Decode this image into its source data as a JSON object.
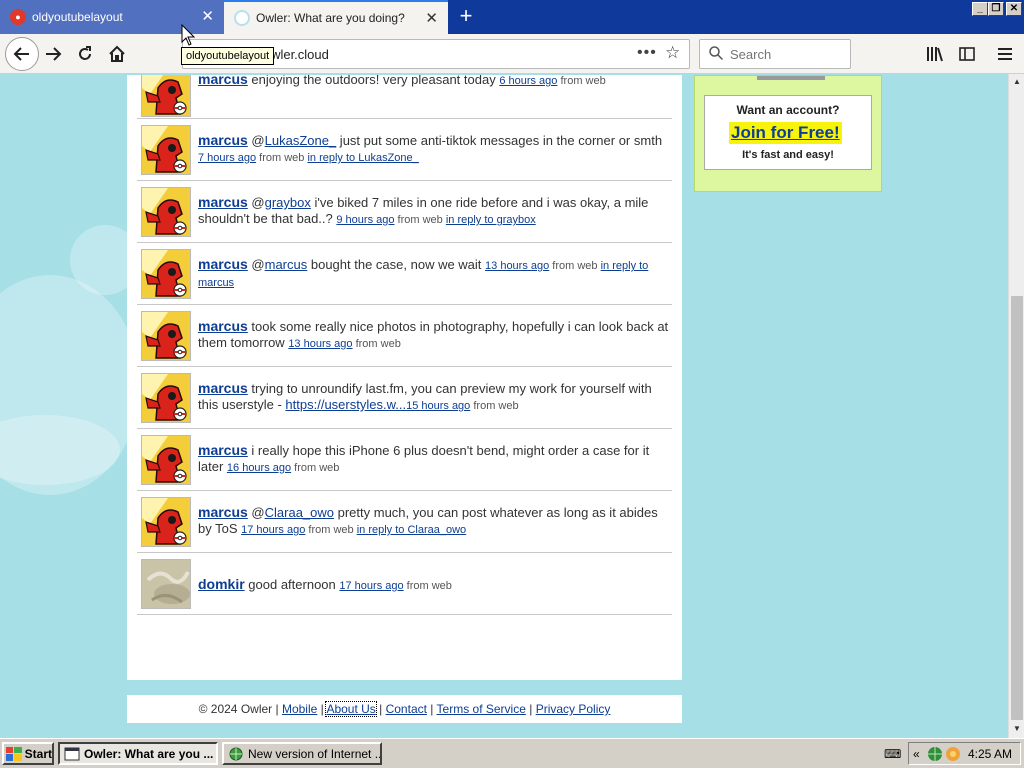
{
  "browser": {
    "tabs": [
      {
        "label": "oldyoutubelayout"
      },
      {
        "label": "Owler: What are you doing?"
      }
    ],
    "url": "://owler.cloud",
    "search_placeholder": "Search",
    "tooltip": "oldyoutubelayout",
    "page_actions": "•••"
  },
  "statuses": [
    {
      "user": "marcus",
      "pre": "",
      "mention": "",
      "text": " enjoying the outdoors! very pleasant today ",
      "time": "6 hours ago",
      "from": " from web",
      "reply": "",
      "avatar": "red-robot"
    },
    {
      "user": "marcus",
      "pre": " @",
      "mention": "LukasZone_",
      "text": " just put some anti-tiktok messages in the corner or smth ",
      "time": "7 hours ago",
      "from": " from web ",
      "reply": "in reply to LukasZone_",
      "avatar": "red-robot"
    },
    {
      "user": "marcus",
      "pre": " @",
      "mention": "graybox",
      "text": " i've biked 7 miles in one ride before and i was okay, a mile shouldn't be that bad..? ",
      "time": "9 hours ago",
      "from": " from web ",
      "reply": "in reply to graybox",
      "avatar": "red-robot"
    },
    {
      "user": "marcus",
      "pre": " @",
      "mention": "marcus",
      "text": " bought the case, now we wait ",
      "time": "13 hours ago",
      "from": " from web ",
      "reply": "in reply to marcus",
      "avatar": "red-robot"
    },
    {
      "user": "marcus",
      "pre": "",
      "mention": "",
      "text": " took some really nice photos in photography, hopefully i can look back at them tomorrow ",
      "time": "13 hours ago",
      "from": " from web",
      "reply": "",
      "avatar": "red-robot"
    },
    {
      "user": "marcus",
      "pre": "",
      "mention": "",
      "text": " trying to unroundify last.fm, you can preview my work for yourself with this userstyle - ",
      "link": "https://userstyles.w...",
      "time": "15 hours ago",
      "from": " from web",
      "reply": "",
      "avatar": "red-robot"
    },
    {
      "user": "marcus",
      "pre": "",
      "mention": "",
      "text": " i really hope this iPhone 6 plus doesn't bend, might order a case for it later ",
      "time": "16 hours ago",
      "from": " from web",
      "reply": "",
      "avatar": "red-robot"
    },
    {
      "user": "marcus",
      "pre": " @",
      "mention": "Claraa_owo",
      "text": " pretty much, you can post whatever as long as it abides by ToS ",
      "time": "17 hours ago",
      "from": " from web ",
      "reply": "in reply to Claraa_owo",
      "avatar": "red-robot"
    },
    {
      "user": "domkir",
      "pre": "",
      "mention": "",
      "text": " good afternoon ",
      "time": "17 hours ago",
      "from": " from web",
      "reply": "",
      "avatar": "photo"
    }
  ],
  "signup": {
    "want": "Want an account?",
    "join": "Join for Free!",
    "easy": "It's fast and easy!"
  },
  "footer": {
    "copyright": "© 2024 Owler",
    "sep": " | ",
    "links": [
      "Mobile",
      "About Us",
      "Contact",
      "Terms of Service",
      "Privacy Policy"
    ]
  },
  "taskbar": {
    "start": "Start",
    "tasks": [
      "Owler: What are you ...",
      "New version of Internet ..."
    ],
    "tray_chevron": "«",
    "clock": "4:25 AM"
  },
  "colors": {
    "page_bg": "#a6e0e6",
    "link": "#0d3e94",
    "signup_bg": "#dcf7a0",
    "join_highlight": "#f7f30c",
    "tabstrip": "#0f3a9c"
  }
}
